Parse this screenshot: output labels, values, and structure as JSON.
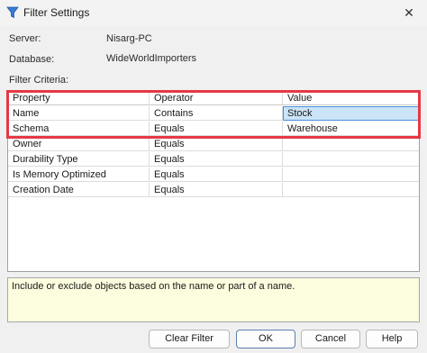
{
  "window": {
    "title": "Filter Settings"
  },
  "info": {
    "server_label": "Server:",
    "server_value": "Nisarg-PC",
    "database_label": "Database:",
    "database_value": "WideWorldImporters",
    "criteria_label": "Filter Criteria:"
  },
  "grid": {
    "headers": [
      "Property",
      "Operator",
      "Value"
    ],
    "rows": [
      [
        "Name",
        "Contains",
        "Stock"
      ],
      [
        "Schema",
        "Equals",
        "Warehouse"
      ],
      [
        "Owner",
        "Equals",
        ""
      ],
      [
        "Durability Type",
        "Equals",
        ""
      ],
      [
        "Is Memory Optimized",
        "Equals",
        ""
      ],
      [
        "Creation Date",
        "Equals",
        ""
      ]
    ],
    "selected_cell": "Name value"
  },
  "description": "Include or exclude objects based on the name or part of a name.",
  "buttons": {
    "clear_filter": "Clear Filter",
    "ok": "OK",
    "cancel": "Cancel",
    "help": "Help"
  },
  "icons": {
    "title": "filter-icon",
    "close": "close-icon"
  },
  "colors": {
    "highlight": "#e53945",
    "selection": "#cce4f7",
    "description_bg": "#fcfcde"
  }
}
